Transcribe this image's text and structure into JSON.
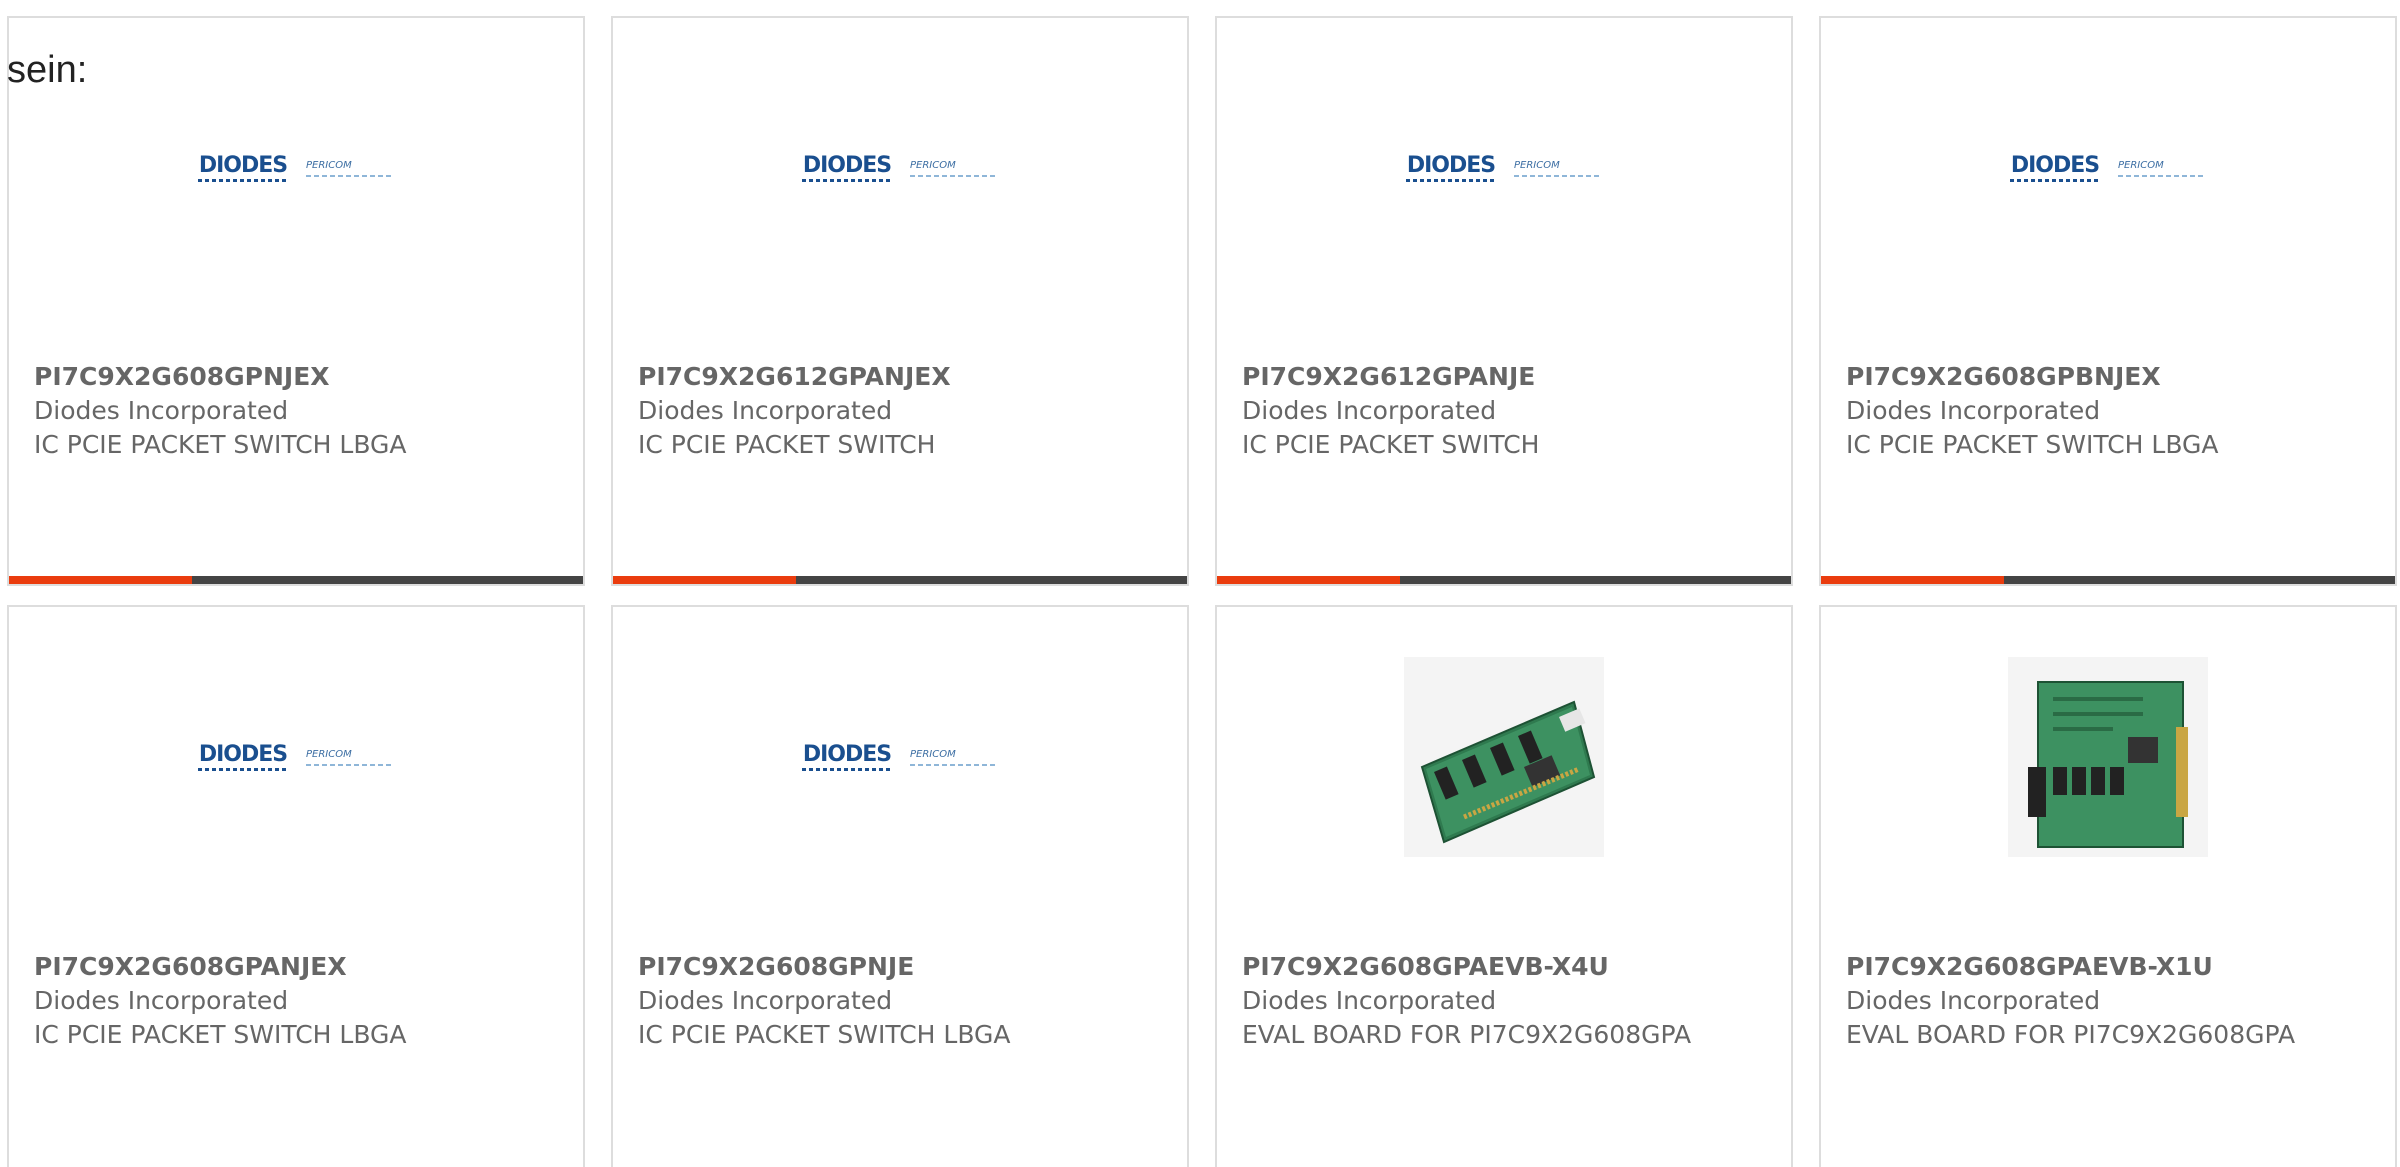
{
  "intro_text": "sein:",
  "colors": {
    "accent": "#ea3c0e",
    "bar": "#444444",
    "text": "#666666",
    "border": "#dddddd"
  },
  "cards": [
    {
      "part": "PI7C9X2G608GPNJEX",
      "manufacturer": "Diodes Incorporated",
      "description": "IC PCIE PACKET SWITCH LBGA",
      "image": "diodes-pericom-logo"
    },
    {
      "part": "PI7C9X2G612GPANJEX",
      "manufacturer": "Diodes Incorporated",
      "description": "IC PCIE PACKET SWITCH",
      "image": "diodes-pericom-logo"
    },
    {
      "part": "PI7C9X2G612GPANJE",
      "manufacturer": "Diodes Incorporated",
      "description": "IC PCIE PACKET SWITCH",
      "image": "diodes-pericom-logo"
    },
    {
      "part": "PI7C9X2G608GPBNJEX",
      "manufacturer": "Diodes Incorporated",
      "description": "IC PCIE PACKET SWITCH LBGA",
      "image": "diodes-pericom-logo"
    },
    {
      "part": "PI7C9X2G608GPANJEX",
      "manufacturer": "Diodes Incorporated",
      "description": "IC PCIE PACKET SWITCH LBGA",
      "image": "diodes-pericom-logo"
    },
    {
      "part": "PI7C9X2G608GPNJE",
      "manufacturer": "Diodes Incorporated",
      "description": "IC PCIE PACKET SWITCH LBGA",
      "image": "diodes-pericom-logo"
    },
    {
      "part": "PI7C9X2G608GPAEVB-X4U",
      "manufacturer": "Diodes Incorporated",
      "description": "EVAL BOARD FOR PI7C9X2G608GPA",
      "image": "eval-board-photo"
    },
    {
      "part": "PI7C9X2G608GPAEVB-X1U",
      "manufacturer": "Diodes Incorporated",
      "description": "EVAL BOARD FOR PI7C9X2G608GPA",
      "image": "eval-board-photo"
    }
  ],
  "logo": {
    "brand1": "DIODES",
    "brand2": "PERICOM"
  }
}
